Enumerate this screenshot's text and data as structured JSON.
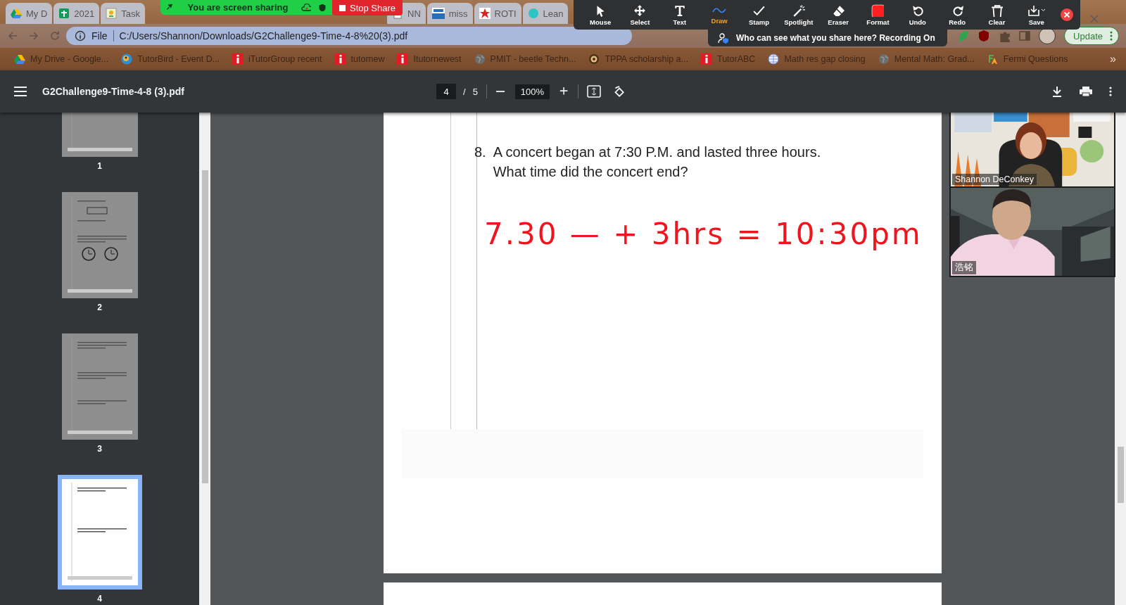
{
  "browser": {
    "tabs": [
      {
        "label": "My D",
        "kind": "drive"
      },
      {
        "label": "2021",
        "kind": "sheets"
      },
      {
        "label": "Task",
        "kind": "task"
      },
      {
        "label": "NN",
        "kind": "doc"
      },
      {
        "label": "miss",
        "kind": "mw"
      },
      {
        "label": "ROTI",
        "kind": "star"
      },
      {
        "label": "Lean",
        "kind": "circle"
      }
    ],
    "address": {
      "scheme": "File",
      "url": "C:/Users/Shannon/Downloads/G2Challenge9-Time-4-8%20(3).pdf"
    },
    "update_button": "Update",
    "bookmarks": [
      {
        "label": "My Drive - Google...",
        "kind": "drive"
      },
      {
        "label": "TutorBird - Event D...",
        "kind": "bird"
      },
      {
        "label": "iTutorGroup recent",
        "kind": "itutor"
      },
      {
        "label": "tutornew",
        "kind": "itutor"
      },
      {
        "label": "Itutornewest",
        "kind": "itutor"
      },
      {
        "label": "PMIT - beetle Techn...",
        "kind": "globe"
      },
      {
        "label": "TPPA scholarship a...",
        "kind": "crest"
      },
      {
        "label": "TutorABC",
        "kind": "itutor"
      },
      {
        "label": "Math res gap closing",
        "kind": "web"
      },
      {
        "label": "Mental Math: Grad...",
        "kind": "globe"
      },
      {
        "label": "Fermi Questions",
        "kind": "fa"
      }
    ],
    "bookmarks_more": "»"
  },
  "share_banner": {
    "status": "You are screen sharing",
    "stop_button": "Stop Share"
  },
  "annotation_toolbar": {
    "tools": [
      {
        "label": "Mouse",
        "kind": "mouse",
        "selected": false
      },
      {
        "label": "Select",
        "kind": "select",
        "selected": false
      },
      {
        "label": "Text",
        "kind": "text",
        "selected": false
      },
      {
        "label": "Draw",
        "kind": "draw",
        "selected": true
      },
      {
        "label": "Stamp",
        "kind": "stamp",
        "selected": false
      },
      {
        "label": "Spotlight",
        "kind": "spotlight",
        "selected": false
      },
      {
        "label": "Eraser",
        "kind": "eraser",
        "selected": false
      },
      {
        "label": "Format",
        "kind": "format",
        "selected": false
      },
      {
        "label": "Undo",
        "kind": "undo",
        "selected": false
      },
      {
        "label": "Redo",
        "kind": "redo",
        "selected": false
      },
      {
        "label": "Clear",
        "kind": "clear",
        "selected": false
      },
      {
        "label": "Save",
        "kind": "save",
        "selected": false
      }
    ],
    "notice": "Who can see what you share here? Recording On"
  },
  "pdf_toolbar": {
    "title": "G2Challenge9-Time-4-8 (3).pdf",
    "page": "4",
    "separator": "/",
    "page_count": "5",
    "zoom": "100%"
  },
  "thumbnails": [
    {
      "label": "1",
      "selected": false
    },
    {
      "label": "2",
      "selected": false
    },
    {
      "label": "3",
      "selected": false
    },
    {
      "label": "4",
      "selected": true
    }
  ],
  "page": {
    "number": "8.",
    "question_lines": [
      "A concert began at 7:30 P.M. and lasted three hours.",
      "What time did the concert end?"
    ],
    "annotation": "7.30 — + 3hrs = 10:30pm"
  },
  "video": [
    {
      "name": "Shannon DeConkey",
      "kind": "picture"
    },
    {
      "name": "浩铭",
      "kind": "picture"
    }
  ]
}
